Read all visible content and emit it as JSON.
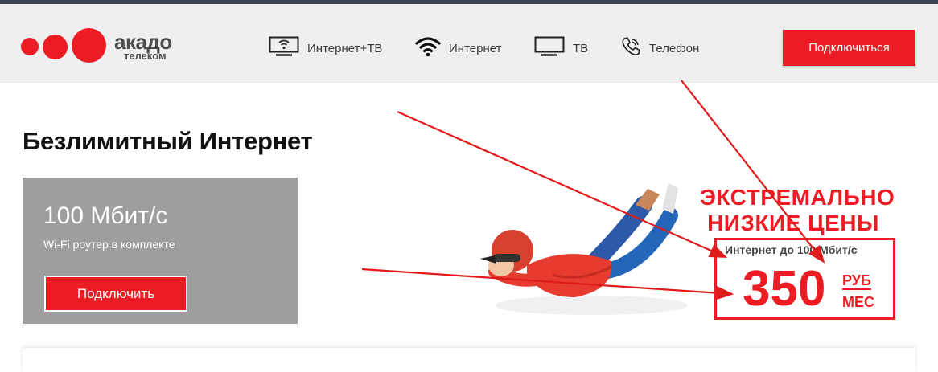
{
  "brand": {
    "name": "акадо",
    "subname": "телеком"
  },
  "nav": {
    "items": [
      {
        "label": "Интернет+ТВ",
        "icon": "tv-wifi-icon"
      },
      {
        "label": "Интернет",
        "icon": "wifi-icon"
      },
      {
        "label": "ТВ",
        "icon": "tv-icon"
      },
      {
        "label": "Телефон",
        "icon": "phone-icon"
      }
    ],
    "cta_label": "Подключиться"
  },
  "main": {
    "title": "Безлимитный Интернет",
    "plan": {
      "speed": "100 Мбит/с",
      "note": "Wi-Fi роутер в комплекте",
      "button_label": "Подключить"
    }
  },
  "promo": {
    "headline_line1": "ЭКСТРЕМАЛЬНО",
    "headline_line2": "НИЗКИЕ ЦЕНЫ",
    "subtitle": "Интернет до 100 Мбит/с",
    "price": "350",
    "unit_top": "РУБ",
    "unit_bottom": "МЕС"
  },
  "colors": {
    "accent": "#ec1c24",
    "header_bg": "#efefef",
    "card_bg": "#9e9e9e",
    "top_strip": "#3b4150"
  }
}
